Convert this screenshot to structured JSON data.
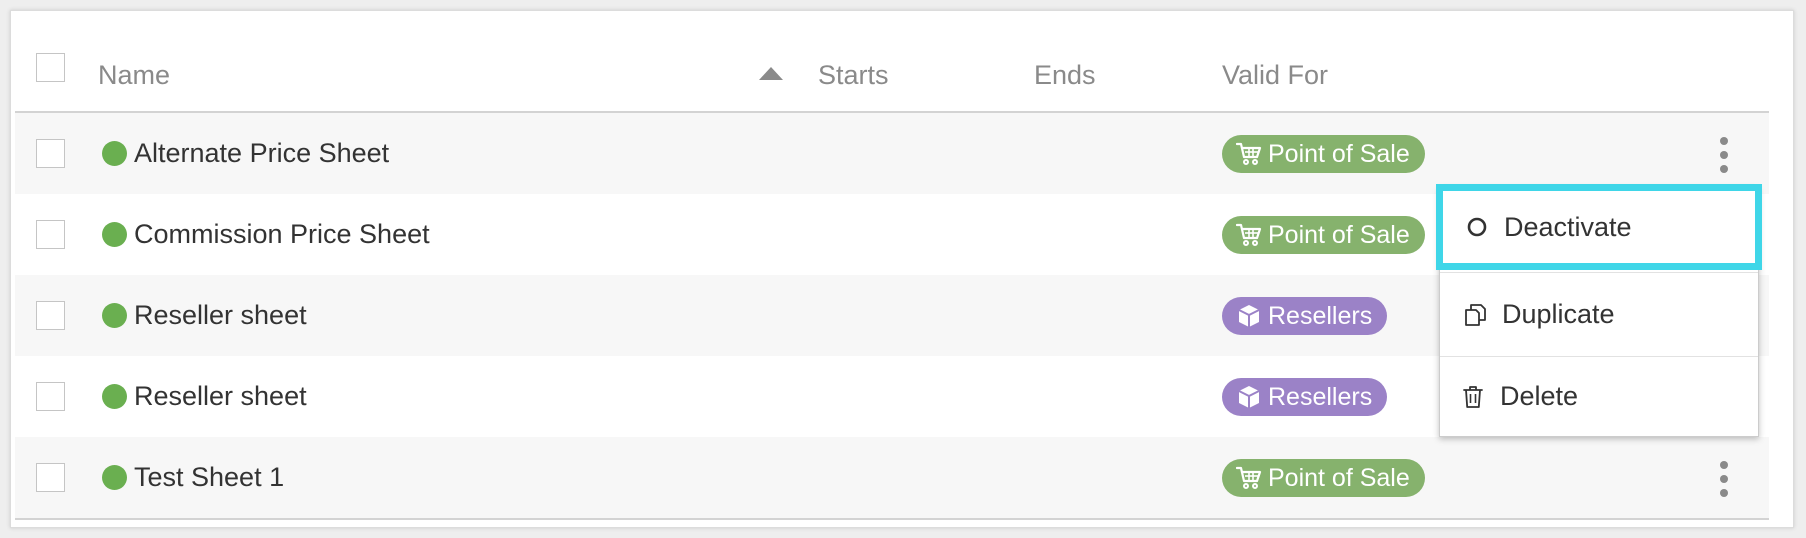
{
  "colors": {
    "active_dot": "#6aaf50",
    "point_of_sale": "#86b26d",
    "resellers": "#9b82c7",
    "highlight": "#3fd6e8"
  },
  "table": {
    "headers": {
      "name": "Name",
      "starts": "Starts",
      "ends": "Ends",
      "valid_for": "Valid For"
    },
    "rows": [
      {
        "name": "Alternate Price Sheet",
        "valid_for": "Point of Sale",
        "valid_icon": "cart-icon",
        "status": "active"
      },
      {
        "name": "Commission Price Sheet",
        "valid_for": "Point of Sale",
        "valid_icon": "cart-icon",
        "status": "active"
      },
      {
        "name": "Reseller sheet",
        "valid_for": "Resellers",
        "valid_icon": "box-icon",
        "status": "active"
      },
      {
        "name": "Reseller sheet",
        "valid_for": "Resellers",
        "valid_icon": "box-icon",
        "status": "active"
      },
      {
        "name": "Test Sheet 1",
        "valid_for": "Point of Sale",
        "valid_icon": "cart-icon",
        "status": "active"
      }
    ]
  },
  "context_menu": {
    "deactivate": "Deactivate",
    "duplicate": "Duplicate",
    "delete": "Delete"
  }
}
